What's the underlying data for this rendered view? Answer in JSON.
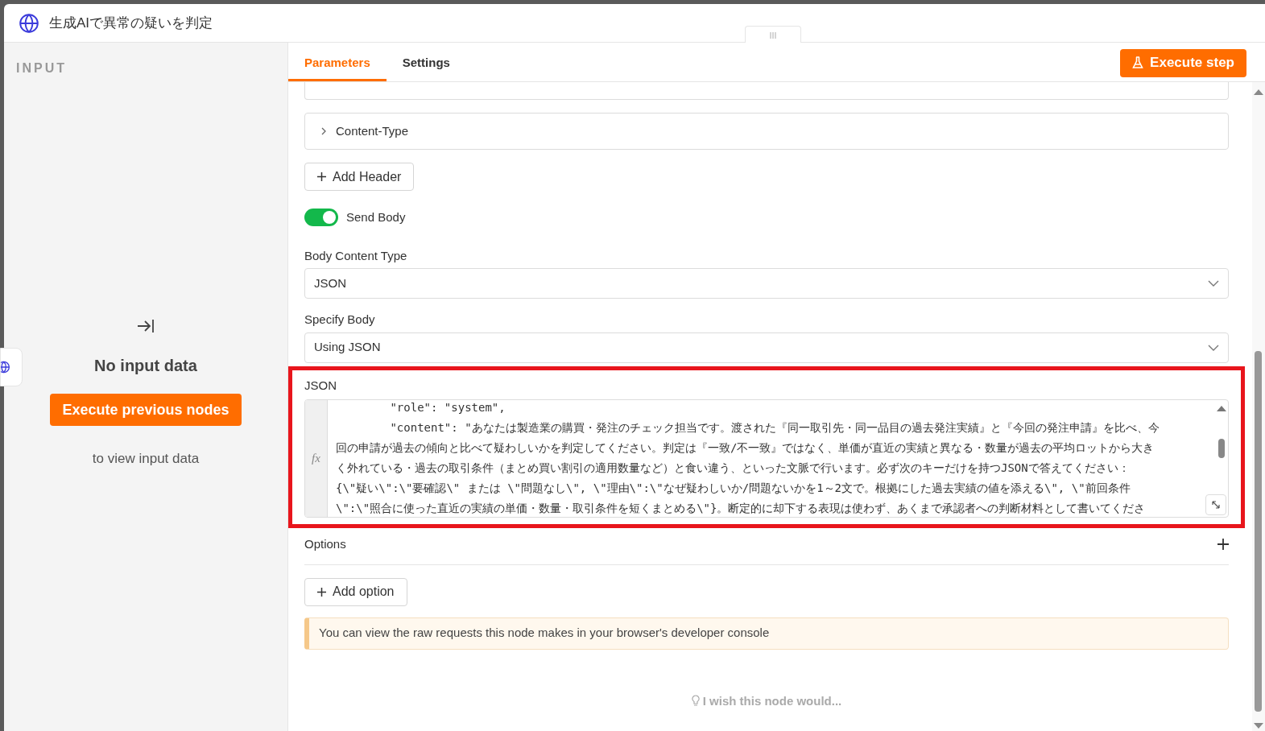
{
  "window": {
    "title": "生成AIで異常の疑いを判定"
  },
  "input_panel": {
    "heading": "INPUT",
    "message": "No input data",
    "button": "Execute previous nodes",
    "hint": "to view input data"
  },
  "tabs": [
    {
      "label": "Parameters",
      "selected": true
    },
    {
      "label": "Settings",
      "selected": false
    }
  ],
  "execute_button": "Execute step",
  "headers": [
    {
      "label": "Content-Type",
      "expanded": false
    }
  ],
  "add_header_button": "Add Header",
  "send_body": {
    "label": "Send Body",
    "on": true
  },
  "body_content_type": {
    "label": "Body Content Type",
    "value": "JSON"
  },
  "specify_body": {
    "label": "Specify Body",
    "value": "Using JSON"
  },
  "json_field": {
    "label": "JSON",
    "highlighted": true,
    "expression_marker": "fx",
    "lines": [
      "        \"role\": \"system\",",
      "        \"content\": \"あなたは製造業の購買・発注のチェック担当です。渡された『同一取引先・同一品目の過去発注実績』と『今回の発注申請』を比べ、今",
      "回の申請が過去の傾向と比べて疑わしいかを判定してください。判定は『一致/不一致』ではなく、単価が直近の実績と異なる・数量が過去の平均ロットから大き",
      "く外れている・過去の取引条件（まとめ買い割引の適用数量など）と食い違う、といった文脈で行います。必ず次のキーだけを持つJSONで答えてください：",
      "{\\\"疑い\\\":\\\"要確認\\\" または \\\"問題なし\\\", \\\"理由\\\":\\\"なぜ疑わしいか/問題ないかを1～2文で。根拠にした過去実績の値を添える\\\", \\\"前回条件",
      "\\\":\\\"照合に使った直近の実績の単価・数量・取引条件を短くまとめる\\\"}。断定的に却下する表現は使わず、あくまで承認者への判断材料として書いてくださ"
    ]
  },
  "options": {
    "label": "Options",
    "add_button": "Add option"
  },
  "notice": "You can view the raw requests this node makes in your browser's developer console",
  "feedback_link": "I wish this node would..."
}
